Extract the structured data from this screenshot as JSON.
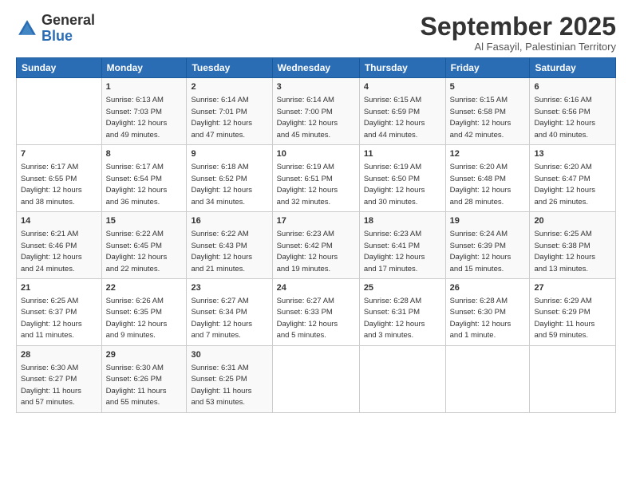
{
  "header": {
    "logo_general": "General",
    "logo_blue": "Blue",
    "month_title": "September 2025",
    "subtitle": "Al Fasayil, Palestinian Territory"
  },
  "days_of_week": [
    "Sunday",
    "Monday",
    "Tuesday",
    "Wednesday",
    "Thursday",
    "Friday",
    "Saturday"
  ],
  "weeks": [
    [
      {
        "day": "",
        "info": ""
      },
      {
        "day": "1",
        "info": "Sunrise: 6:13 AM\nSunset: 7:03 PM\nDaylight: 12 hours\nand 49 minutes."
      },
      {
        "day": "2",
        "info": "Sunrise: 6:14 AM\nSunset: 7:01 PM\nDaylight: 12 hours\nand 47 minutes."
      },
      {
        "day": "3",
        "info": "Sunrise: 6:14 AM\nSunset: 7:00 PM\nDaylight: 12 hours\nand 45 minutes."
      },
      {
        "day": "4",
        "info": "Sunrise: 6:15 AM\nSunset: 6:59 PM\nDaylight: 12 hours\nand 44 minutes."
      },
      {
        "day": "5",
        "info": "Sunrise: 6:15 AM\nSunset: 6:58 PM\nDaylight: 12 hours\nand 42 minutes."
      },
      {
        "day": "6",
        "info": "Sunrise: 6:16 AM\nSunset: 6:56 PM\nDaylight: 12 hours\nand 40 minutes."
      }
    ],
    [
      {
        "day": "7",
        "info": "Sunrise: 6:17 AM\nSunset: 6:55 PM\nDaylight: 12 hours\nand 38 minutes."
      },
      {
        "day": "8",
        "info": "Sunrise: 6:17 AM\nSunset: 6:54 PM\nDaylight: 12 hours\nand 36 minutes."
      },
      {
        "day": "9",
        "info": "Sunrise: 6:18 AM\nSunset: 6:52 PM\nDaylight: 12 hours\nand 34 minutes."
      },
      {
        "day": "10",
        "info": "Sunrise: 6:19 AM\nSunset: 6:51 PM\nDaylight: 12 hours\nand 32 minutes."
      },
      {
        "day": "11",
        "info": "Sunrise: 6:19 AM\nSunset: 6:50 PM\nDaylight: 12 hours\nand 30 minutes."
      },
      {
        "day": "12",
        "info": "Sunrise: 6:20 AM\nSunset: 6:48 PM\nDaylight: 12 hours\nand 28 minutes."
      },
      {
        "day": "13",
        "info": "Sunrise: 6:20 AM\nSunset: 6:47 PM\nDaylight: 12 hours\nand 26 minutes."
      }
    ],
    [
      {
        "day": "14",
        "info": "Sunrise: 6:21 AM\nSunset: 6:46 PM\nDaylight: 12 hours\nand 24 minutes."
      },
      {
        "day": "15",
        "info": "Sunrise: 6:22 AM\nSunset: 6:45 PM\nDaylight: 12 hours\nand 22 minutes."
      },
      {
        "day": "16",
        "info": "Sunrise: 6:22 AM\nSunset: 6:43 PM\nDaylight: 12 hours\nand 21 minutes."
      },
      {
        "day": "17",
        "info": "Sunrise: 6:23 AM\nSunset: 6:42 PM\nDaylight: 12 hours\nand 19 minutes."
      },
      {
        "day": "18",
        "info": "Sunrise: 6:23 AM\nSunset: 6:41 PM\nDaylight: 12 hours\nand 17 minutes."
      },
      {
        "day": "19",
        "info": "Sunrise: 6:24 AM\nSunset: 6:39 PM\nDaylight: 12 hours\nand 15 minutes."
      },
      {
        "day": "20",
        "info": "Sunrise: 6:25 AM\nSunset: 6:38 PM\nDaylight: 12 hours\nand 13 minutes."
      }
    ],
    [
      {
        "day": "21",
        "info": "Sunrise: 6:25 AM\nSunset: 6:37 PM\nDaylight: 12 hours\nand 11 minutes."
      },
      {
        "day": "22",
        "info": "Sunrise: 6:26 AM\nSunset: 6:35 PM\nDaylight: 12 hours\nand 9 minutes."
      },
      {
        "day": "23",
        "info": "Sunrise: 6:27 AM\nSunset: 6:34 PM\nDaylight: 12 hours\nand 7 minutes."
      },
      {
        "day": "24",
        "info": "Sunrise: 6:27 AM\nSunset: 6:33 PM\nDaylight: 12 hours\nand 5 minutes."
      },
      {
        "day": "25",
        "info": "Sunrise: 6:28 AM\nSunset: 6:31 PM\nDaylight: 12 hours\nand 3 minutes."
      },
      {
        "day": "26",
        "info": "Sunrise: 6:28 AM\nSunset: 6:30 PM\nDaylight: 12 hours\nand 1 minute."
      },
      {
        "day": "27",
        "info": "Sunrise: 6:29 AM\nSunset: 6:29 PM\nDaylight: 11 hours\nand 59 minutes."
      }
    ],
    [
      {
        "day": "28",
        "info": "Sunrise: 6:30 AM\nSunset: 6:27 PM\nDaylight: 11 hours\nand 57 minutes."
      },
      {
        "day": "29",
        "info": "Sunrise: 6:30 AM\nSunset: 6:26 PM\nDaylight: 11 hours\nand 55 minutes."
      },
      {
        "day": "30",
        "info": "Sunrise: 6:31 AM\nSunset: 6:25 PM\nDaylight: 11 hours\nand 53 minutes."
      },
      {
        "day": "",
        "info": ""
      },
      {
        "day": "",
        "info": ""
      },
      {
        "day": "",
        "info": ""
      },
      {
        "day": "",
        "info": ""
      }
    ]
  ]
}
